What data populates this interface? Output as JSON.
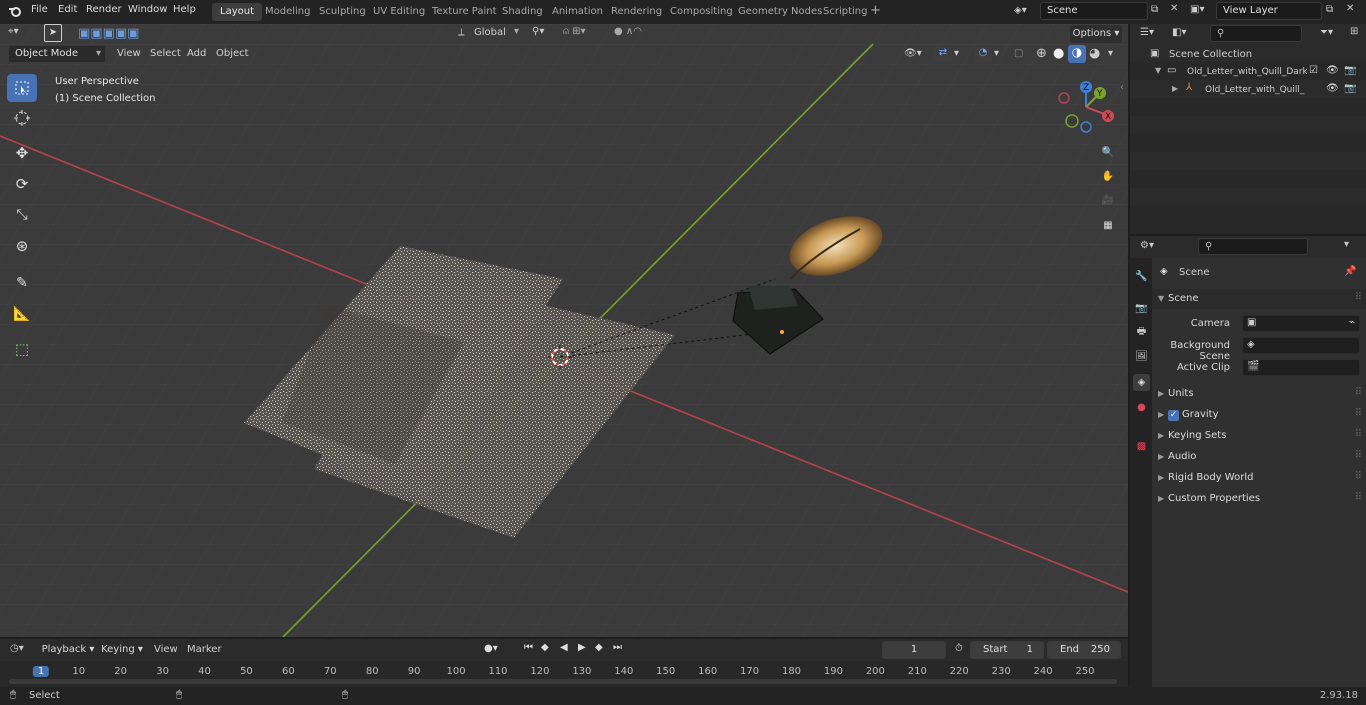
{
  "top_menu": [
    "File",
    "Edit",
    "Render",
    "Window",
    "Help"
  ],
  "workspaces": [
    "Layout",
    "Modeling",
    "Sculpting",
    "UV Editing",
    "Texture Paint",
    "Shading",
    "Animation",
    "Rendering",
    "Compositing",
    "Geometry Nodes",
    "Scripting"
  ],
  "active_workspace": "Layout",
  "scene_field": "Scene",
  "view_layer_field": "View Layer",
  "header": {
    "mode": "Object Mode",
    "menus": [
      "View",
      "Select",
      "Add",
      "Object"
    ],
    "transform_orientation": "Global",
    "options": "Options"
  },
  "viewport": {
    "overlay_line1": "User Perspective",
    "overlay_line2": "(1) Scene Collection",
    "gizmo": {
      "x": "X",
      "y": "Y",
      "z": "Z"
    }
  },
  "outliner": {
    "root": "Scene Collection",
    "items": [
      {
        "label": "Old_Letter_with_Quill_Dark_F"
      },
      {
        "label": "Old_Letter_with_Quill_Da"
      }
    ]
  },
  "properties": {
    "breadcrumb": "Scene",
    "panel": "Scene",
    "fields": [
      {
        "label": "Camera"
      },
      {
        "label": "Background Scene"
      },
      {
        "label": "Active Clip"
      }
    ],
    "sections": [
      "Units",
      "Gravity",
      "Keying Sets",
      "Audio",
      "Rigid Body World",
      "Custom Properties"
    ]
  },
  "timeline": {
    "menus": [
      "Playback",
      "Keying",
      "View",
      "Marker"
    ],
    "current_frame": "1",
    "start_label": "Start",
    "start_value": "1",
    "end_label": "End",
    "end_value": "250",
    "ticks": [
      "1",
      "10",
      "20",
      "30",
      "40",
      "50",
      "60",
      "70",
      "80",
      "90",
      "100",
      "110",
      "120",
      "130",
      "140",
      "150",
      "160",
      "170",
      "180",
      "190",
      "200",
      "210",
      "220",
      "230",
      "240",
      "250"
    ]
  },
  "status": {
    "left": "Select",
    "version": "2.93.18"
  },
  "colors": {
    "accent": "#4772b3",
    "x_axis": "#b4434f",
    "y_axis": "#79a12b"
  }
}
